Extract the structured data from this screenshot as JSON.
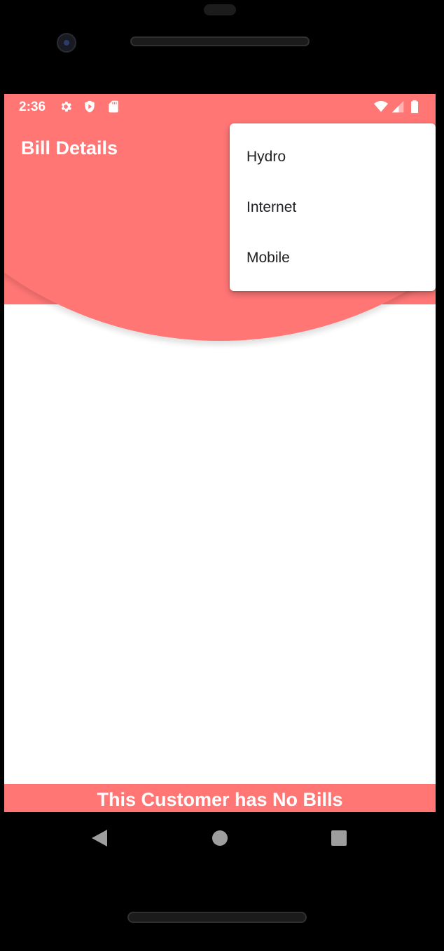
{
  "status_bar": {
    "time": "2:36",
    "left_icons": [
      "gear-icon",
      "shield-play-icon",
      "sd-card-icon"
    ],
    "right_icons": [
      "wifi-icon",
      "signal-icon",
      "battery-icon"
    ]
  },
  "header": {
    "title": "Bill Details",
    "color": "#ff7675"
  },
  "menu": {
    "items": [
      {
        "label": "Hydro"
      },
      {
        "label": "Internet"
      },
      {
        "label": "Mobile"
      }
    ]
  },
  "banner": {
    "text": "This Customer has No Bills",
    "color": "#ff7675"
  },
  "nav_bar": {
    "buttons": [
      "back-icon",
      "home-icon",
      "recents-icon"
    ]
  }
}
